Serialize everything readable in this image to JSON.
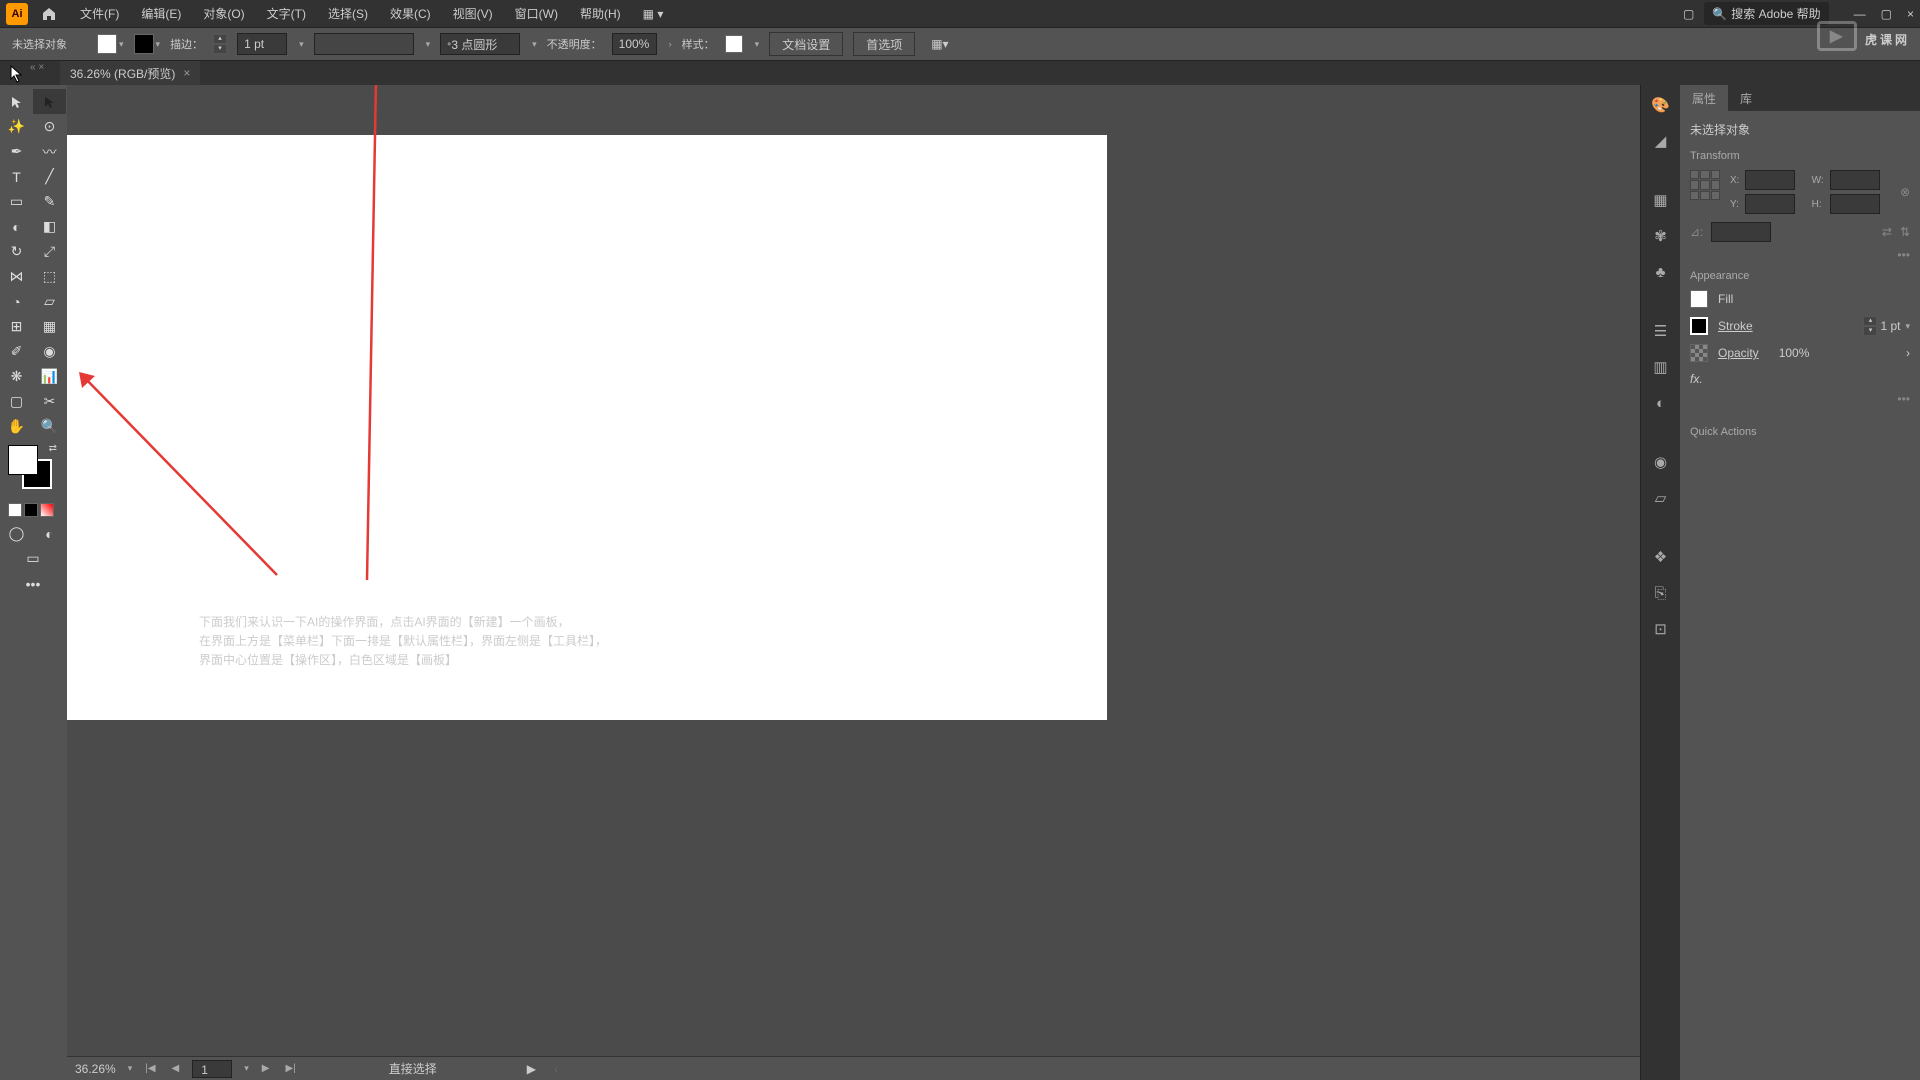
{
  "app": {
    "logo": "Ai"
  },
  "menu": {
    "file": "文件(F)",
    "edit": "编辑(E)",
    "object": "对象(O)",
    "type": "文字(T)",
    "select": "选择(S)",
    "effect": "效果(C)",
    "view": "视图(V)",
    "window": "窗口(W)",
    "help": "帮助(H)"
  },
  "search": {
    "icon": "🔍",
    "placeholder": "搜索 Adobe 帮助"
  },
  "controlbar": {
    "noSelection": "未选择对象",
    "stroke": "描边：",
    "strokeValue": "1 pt",
    "brush": "3 点圆形",
    "opacity": "不透明度：",
    "opacityValue": "100%",
    "style": "样式：",
    "docSetup": "文档设置",
    "prefs": "首选项"
  },
  "docTab": {
    "name": "36.26% (RGB/预览)",
    "close": "×"
  },
  "annotation": {
    "line1": "下面我们来认识一下AI的操作界面，点击AI界面的【新建】一个画板，",
    "line2": "在界面上方是【菜单栏】下面一排是【默认属性栏】，界面左侧是【工具栏】，",
    "line3": "界面中心位置是【操作区】，白色区域是【画板】"
  },
  "panel": {
    "tab1": "属性",
    "tab2": "库",
    "noSel": "未选择对象",
    "transform": "Transform",
    "x": "X:",
    "y": "Y:",
    "w": "W:",
    "h": "H:",
    "appearance": "Appearance",
    "fill": "Fill",
    "strokeLabel": "Stroke",
    "strokeVal": "1 pt",
    "opacityLabel": "Opacity",
    "opacityVal": "100%",
    "fx": "fx.",
    "quickActions": "Quick Actions"
  },
  "status": {
    "zoom": "36.26%",
    "page": "1",
    "tool": "直接选择"
  },
  "watermark": "虎课网"
}
